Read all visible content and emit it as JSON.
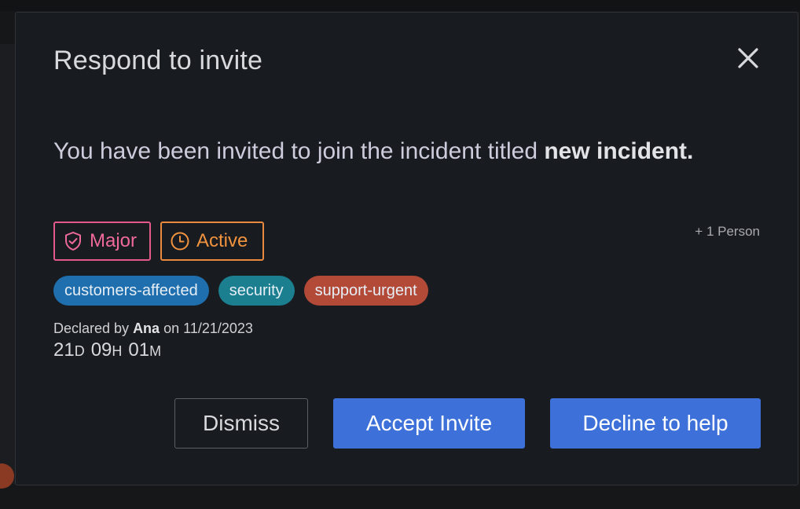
{
  "dialog": {
    "title": "Respond to invite",
    "message_prefix": "You have been invited to join the incident titled",
    "incident_title": "new incident.",
    "people_count": "+ 1 Person",
    "badges": [
      {
        "label": "Major",
        "icon": "shield-check-icon",
        "color": "#e4598a"
      },
      {
        "label": "Active",
        "icon": "clock-icon",
        "color": "#e8893e"
      }
    ],
    "labels": [
      {
        "text": "customers-affected",
        "color": "#1f6fae"
      },
      {
        "text": "security",
        "color": "#1b7f90"
      },
      {
        "text": "support-urgent",
        "color": "#b34a38"
      }
    ],
    "declared": {
      "prefix": "Declared by",
      "author": "Ana",
      "on_word": "on",
      "date": "11/21/2023"
    },
    "elapsed": {
      "days": "21",
      "days_unit": "D",
      "hours": "09",
      "hours_unit": "H",
      "minutes": "01",
      "minutes_unit": "M"
    },
    "buttons": {
      "dismiss": "Dismiss",
      "accept": "Accept Invite",
      "decline": "Decline to help"
    },
    "colors": {
      "primary": "#3d71d9",
      "background": "#181b1f"
    }
  }
}
